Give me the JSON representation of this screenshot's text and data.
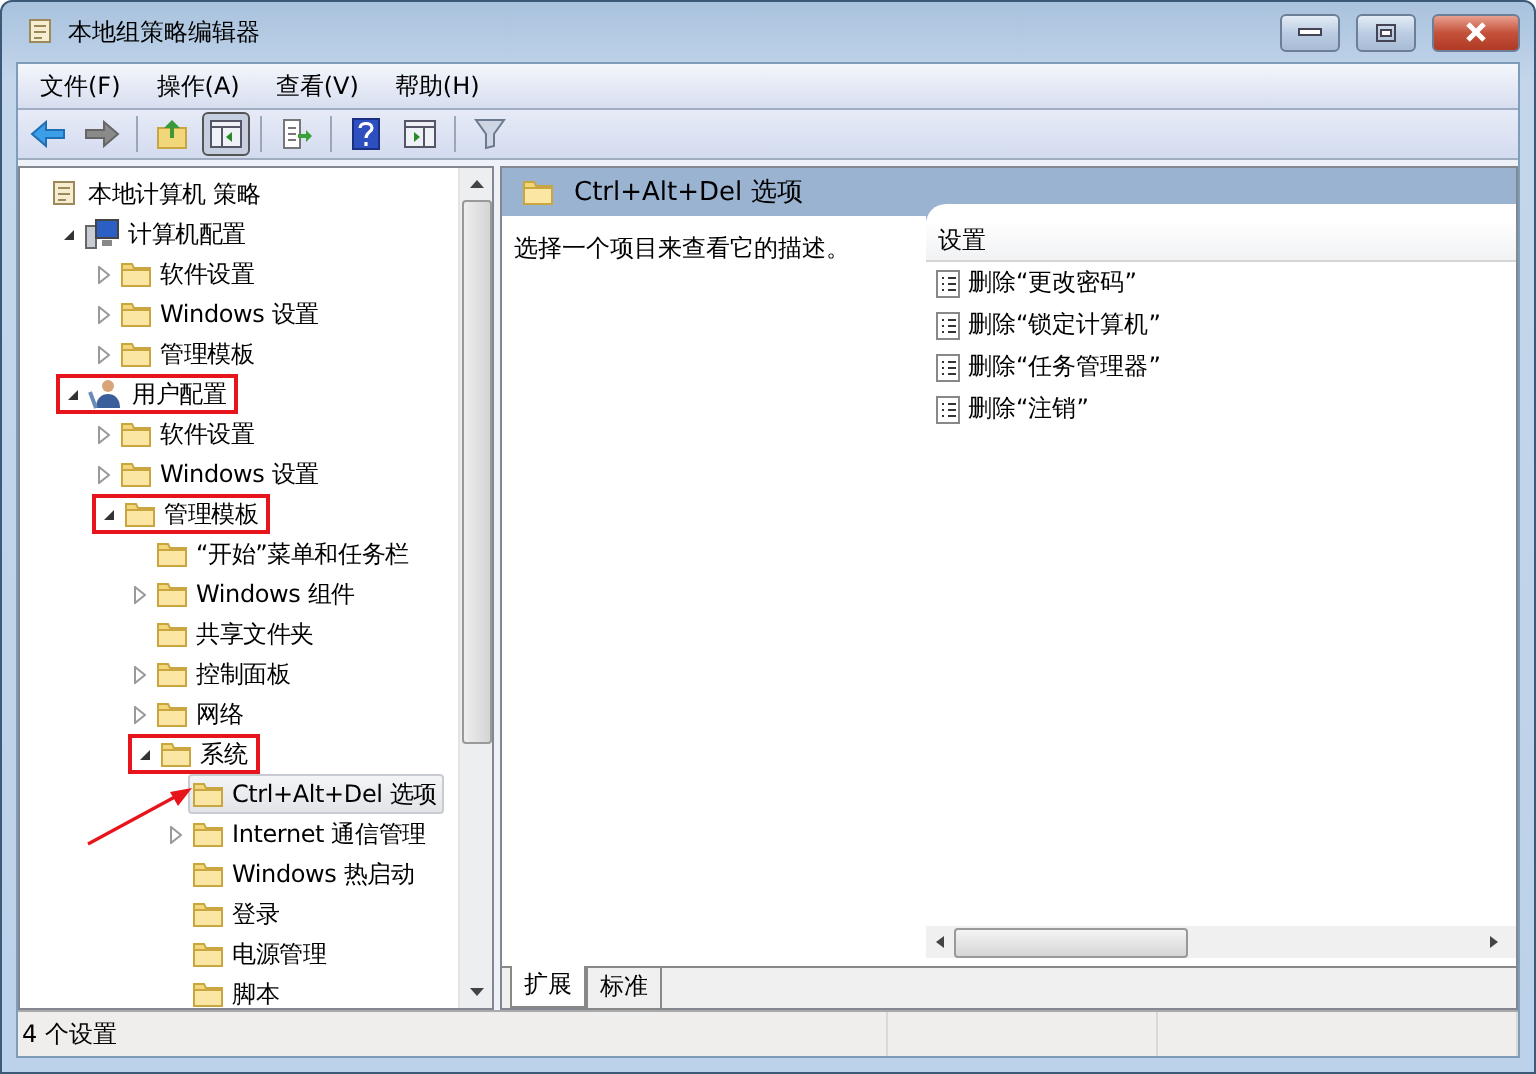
{
  "window": {
    "title": "本地组策略编辑器"
  },
  "menu": [
    "文件(F)",
    "操作(A)",
    "查看(V)",
    "帮助(H)"
  ],
  "toolbar": [
    {
      "kind": "back",
      "pressed": false
    },
    {
      "kind": "forward",
      "pressed": false
    },
    {
      "kind": "separator"
    },
    {
      "kind": "up",
      "pressed": false
    },
    {
      "kind": "tree",
      "pressed": true
    },
    {
      "kind": "separator"
    },
    {
      "kind": "export",
      "pressed": false
    },
    {
      "kind": "separator"
    },
    {
      "kind": "help",
      "pressed": false
    },
    {
      "kind": "pane",
      "pressed": false
    },
    {
      "kind": "separator"
    },
    {
      "kind": "filter",
      "pressed": false
    }
  ],
  "tree": [
    {
      "label": "本地计算机 策略",
      "kind": "policy",
      "expandable": false,
      "highlighted": false,
      "selected": false,
      "children": [
        {
          "label": "计算机配置",
          "kind": "computer",
          "expandable": true,
          "expanded": true,
          "highlighted": false,
          "selected": false,
          "children": [
            {
              "label": "软件设置",
              "kind": "folder",
              "expandable": true,
              "expanded": false,
              "highlighted": false,
              "selected": false
            },
            {
              "label": "Windows 设置",
              "kind": "folder",
              "expandable": true,
              "expanded": false,
              "highlighted": false,
              "selected": false
            },
            {
              "label": "管理模板",
              "kind": "folder",
              "expandable": true,
              "expanded": false,
              "highlighted": false,
              "selected": false
            }
          ]
        },
        {
          "label": "用户配置",
          "kind": "user",
          "expandable": true,
          "expanded": true,
          "highlighted": true,
          "selected": false,
          "children": [
            {
              "label": "软件设置",
              "kind": "folder",
              "expandable": true,
              "expanded": false,
              "highlighted": false,
              "selected": false
            },
            {
              "label": "Windows 设置",
              "kind": "folder",
              "expandable": true,
              "expanded": false,
              "highlighted": false,
              "selected": false
            },
            {
              "label": "管理模板",
              "kind": "folder",
              "expandable": true,
              "expanded": true,
              "highlighted": true,
              "selected": false,
              "children": [
                {
                  "label": "“开始”菜单和任务栏",
                  "kind": "folder",
                  "expandable": false,
                  "highlighted": false,
                  "selected": false
                },
                {
                  "label": "Windows 组件",
                  "kind": "folder",
                  "expandable": true,
                  "expanded": false,
                  "highlighted": false,
                  "selected": false
                },
                {
                  "label": "共享文件夹",
                  "kind": "folder",
                  "expandable": false,
                  "highlighted": false,
                  "selected": false
                },
                {
                  "label": "控制面板",
                  "kind": "folder",
                  "expandable": true,
                  "expanded": false,
                  "highlighted": false,
                  "selected": false
                },
                {
                  "label": "网络",
                  "kind": "folder",
                  "expandable": true,
                  "expanded": false,
                  "highlighted": false,
                  "selected": false
                },
                {
                  "label": "系统",
                  "kind": "folder",
                  "expandable": true,
                  "expanded": true,
                  "highlighted": true,
                  "selected": false,
                  "children": [
                    {
                      "label": "Ctrl+Alt+Del 选项",
                      "kind": "folder",
                      "expandable": false,
                      "highlighted": false,
                      "selected": true
                    },
                    {
                      "label": "Internet 通信管理",
                      "kind": "folder",
                      "expandable": true,
                      "expanded": false,
                      "highlighted": false,
                      "selected": false
                    },
                    {
                      "label": "Windows 热启动",
                      "kind": "folder",
                      "expandable": false,
                      "highlighted": false,
                      "selected": false
                    },
                    {
                      "label": "登录",
                      "kind": "folder",
                      "expandable": false,
                      "highlighted": false,
                      "selected": false
                    },
                    {
                      "label": "电源管理",
                      "kind": "folder",
                      "expandable": false,
                      "highlighted": false,
                      "selected": false
                    },
                    {
                      "label": "脚本",
                      "kind": "folder",
                      "expandable": false,
                      "highlighted": false,
                      "selected": false
                    }
                  ]
                }
              ]
            }
          ]
        }
      ]
    }
  ],
  "details": {
    "title": "Ctrl+Alt+Del 选项",
    "description": "选择一个项目来查看它的描述。",
    "column": "设置",
    "items": [
      "删除“更改密码”",
      "删除“锁定计算机”",
      "删除“任务管理器”",
      "删除“注销”"
    ]
  },
  "tabs": [
    {
      "label": "扩展",
      "selected": true
    },
    {
      "label": "标准",
      "selected": false
    }
  ],
  "status_bar": "4 个设置"
}
